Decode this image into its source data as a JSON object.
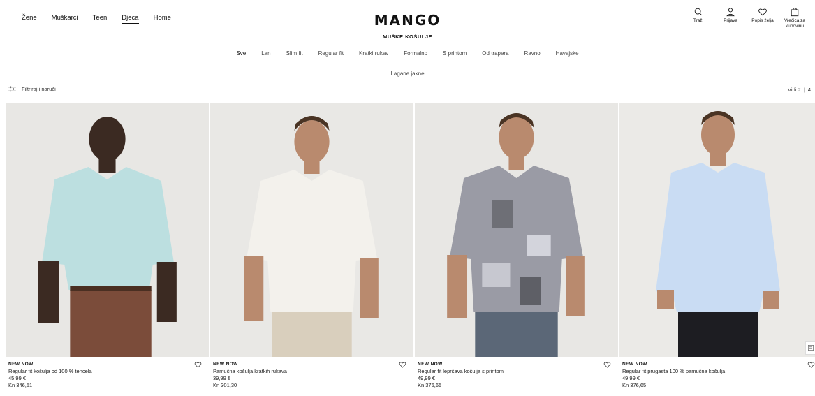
{
  "nav": {
    "items": [
      "Žene",
      "Muškarci",
      "Teen",
      "Djeca",
      "Home"
    ],
    "active": "Djeca"
  },
  "brand": {
    "logo": "MANGO",
    "page_title": "MUŠKE KOŠULJE"
  },
  "utils": {
    "search": "Traži",
    "login": "Prijava",
    "wishlist": "Popis želja",
    "bag": "Vrećica za kupovinu"
  },
  "categories": {
    "row1": [
      "Sve",
      "Lan",
      "Slim fit",
      "Regular fit",
      "Kratki rukav",
      "Formalno",
      "S printom",
      "Od trapera",
      "Ravno",
      "Havajske"
    ],
    "row2": [
      "Lagane jakne"
    ],
    "active": "Sve"
  },
  "filter": {
    "label": "Filtriraj i naruči"
  },
  "view": {
    "label": "Vidi",
    "opt1": "2",
    "sep": "|",
    "opt2": "4"
  },
  "products": [
    {
      "badge": "NEW NOW",
      "name": "Regular fit košulja od 100 % tencela",
      "price_eur": "45,99 €",
      "price_kn": "Kn 346,51",
      "color": "#bcdfe0"
    },
    {
      "badge": "NEW NOW",
      "name": "Pamučna košulja kratkih rukava",
      "price_eur": "39,99 €",
      "price_kn": "Kn 301,30",
      "color": "#f3f1ec"
    },
    {
      "badge": "NEW NOW",
      "name": "Regular fit lepršava košulja s printom",
      "price_eur": "49,99 €",
      "price_kn": "Kn 376,65",
      "color": "#9a9ba5"
    },
    {
      "badge": "NEW NOW",
      "name": "Regular fit prugasta 100 % pamučna košulja",
      "price_eur": "49,99 €",
      "price_kn": "Kn 376,65",
      "color": "#c9dcf3"
    }
  ],
  "icons": [
    "search-icon",
    "user-icon",
    "heart-icon",
    "bag-icon",
    "filter-icon",
    "chat-icon"
  ]
}
